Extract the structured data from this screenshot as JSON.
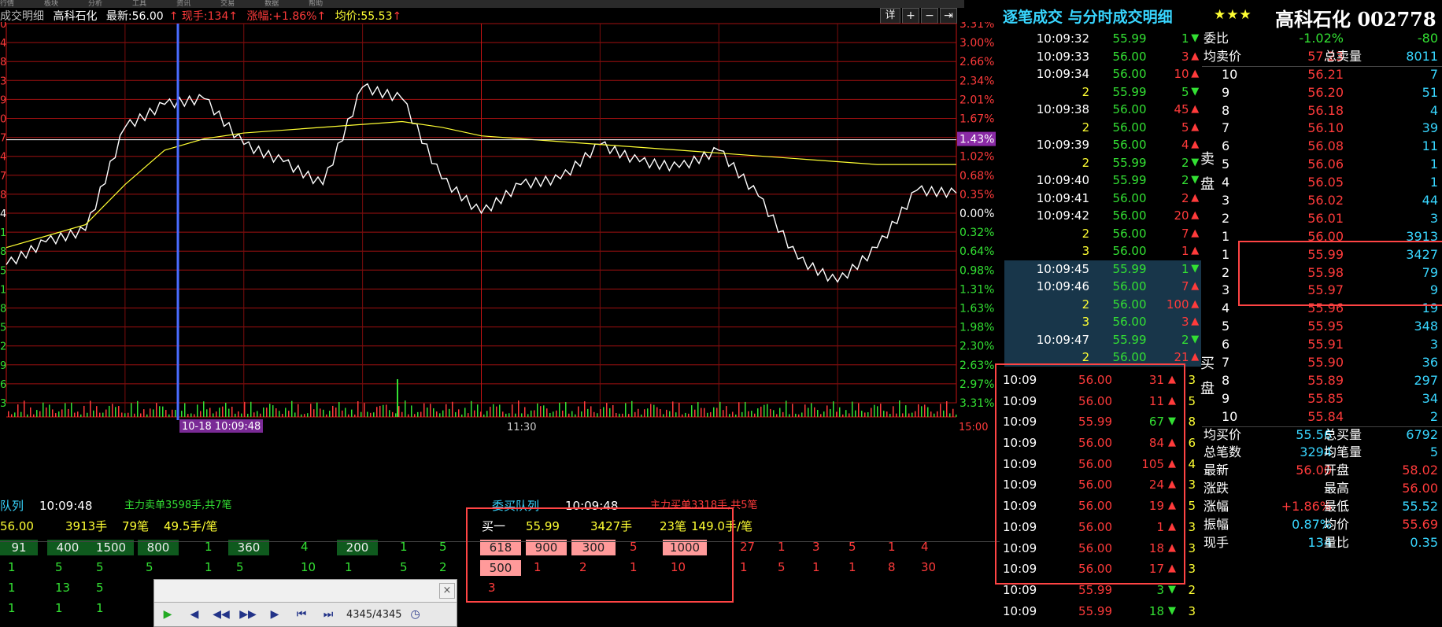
{
  "topbar": {
    "menu": [
      "行情",
      "板块",
      "分析",
      "工具",
      "资讯",
      "交易",
      "数据",
      "帮助"
    ]
  },
  "chart_header": {
    "panel_title": "成交明细",
    "stock_name": "高科石化",
    "latest_label": "最新:",
    "latest_value": "56.00",
    "volume_label": "现手:",
    "volume_value": "134",
    "change_label": "涨幅:",
    "change_value": "+1.86%",
    "avg_label": "均价:",
    "avg_value": "55.53"
  },
  "chart_tools": [
    "详",
    "+",
    "−",
    "⇥"
  ],
  "chart": {
    "pct_labels": [
      "3.31%",
      "3.00%",
      "2.66%",
      "2.34%",
      "2.01%",
      "1.67%",
      "1.43%",
      "1.02%",
      "0.68%",
      "0.35%",
      "0.00%",
      "0.32%",
      "0.64%",
      "0.98%",
      "1.31%",
      "1.63%",
      "1.98%",
      "2.30%",
      "2.63%",
      "2.97%",
      "3.31%"
    ],
    "left_marks": [
      "0",
      "4",
      "8",
      "3",
      "9",
      "0",
      "7",
      "4",
      "7",
      "8",
      "4",
      "1",
      "8",
      "5",
      "1",
      "8",
      "5",
      "2",
      "9",
      "6",
      "3"
    ],
    "cursor_time": "10-18 10:09:48",
    "mid_time": "11:30",
    "end_time": "15:00"
  },
  "chart_data": {
    "type": "line",
    "title": "",
    "xlabel": "",
    "ylabel": "",
    "ylim": [
      -3.31,
      3.31
    ],
    "x": [
      "09:30",
      "09:40",
      "09:50",
      "10:00",
      "10:10",
      "10:20",
      "10:30",
      "10:40",
      "10:50",
      "11:00",
      "11:10",
      "11:20",
      "11:30",
      "13:10",
      "13:20",
      "13:30",
      "13:40",
      "13:50",
      "14:00",
      "14:10",
      "14:20",
      "14:30",
      "14:40",
      "14:50",
      "15:00"
    ],
    "series": [
      {
        "values": [
          -0.9,
          -0.5,
          -0.3,
          1.5,
          1.9,
          2.0,
          1.2,
          0.9,
          0.5,
          2.2,
          2.0,
          0.6,
          0.0,
          0.5,
          0.6,
          1.2,
          0.9,
          0.8,
          1.1,
          0.3,
          -0.8,
          -1.2,
          -0.6,
          0.4,
          0.35
        ]
      },
      {
        "values": [
          -0.6,
          -0.4,
          -0.2,
          0.5,
          1.1,
          1.3,
          1.4,
          1.45,
          1.5,
          1.55,
          1.6,
          1.5,
          1.35,
          1.3,
          1.25,
          1.2,
          1.15,
          1.1,
          1.05,
          1.0,
          0.95,
          0.9,
          0.85,
          0.85,
          0.85
        ]
      }
    ]
  },
  "right_title": {
    "title": "逐笔成交 与分时成交明细",
    "stars": "★★★",
    "stock": "高科石化 002778"
  },
  "ticks": [
    {
      "t": "10:09:32",
      "p": "55.99",
      "v": "1",
      "d": "down",
      "hl": false
    },
    {
      "t": "10:09:33",
      "p": "56.00",
      "v": "3",
      "d": "up",
      "hl": false
    },
    {
      "t": "10:09:34",
      "p": "56.00",
      "v": "10",
      "d": "up",
      "hl": false
    },
    {
      "t": "2",
      "p": "55.99",
      "v": "5",
      "d": "down",
      "hl": false
    },
    {
      "t": "10:09:38",
      "p": "56.00",
      "v": "45",
      "d": "up",
      "hl": false
    },
    {
      "t": "2",
      "p": "56.00",
      "v": "5",
      "d": "up",
      "hl": false
    },
    {
      "t": "10:09:39",
      "p": "56.00",
      "v": "4",
      "d": "up",
      "hl": false
    },
    {
      "t": "2",
      "p": "55.99",
      "v": "2",
      "d": "down",
      "hl": false
    },
    {
      "t": "10:09:40",
      "p": "55.99",
      "v": "2",
      "d": "down",
      "hl": false
    },
    {
      "t": "10:09:41",
      "p": "56.00",
      "v": "2",
      "d": "up",
      "hl": false
    },
    {
      "t": "10:09:42",
      "p": "56.00",
      "v": "20",
      "d": "up",
      "hl": false
    },
    {
      "t": "2",
      "p": "56.00",
      "v": "7",
      "d": "up",
      "hl": false
    },
    {
      "t": "3",
      "p": "56.00",
      "v": "1",
      "d": "up",
      "hl": false
    },
    {
      "t": "10:09:45",
      "p": "55.99",
      "v": "1",
      "d": "down",
      "hl": true
    },
    {
      "t": "10:09:46",
      "p": "56.00",
      "v": "7",
      "d": "up",
      "hl": true
    },
    {
      "t": "2",
      "p": "56.00",
      "v": "100",
      "d": "up",
      "hl": true
    },
    {
      "t": "3",
      "p": "56.00",
      "v": "3",
      "d": "up",
      "hl": true
    },
    {
      "t": "10:09:47",
      "p": "55.99",
      "v": "2",
      "d": "down",
      "hl": true
    },
    {
      "t": "2",
      "p": "56.00",
      "v": "21",
      "d": "up",
      "hl": true
    }
  ],
  "ticks2": [
    {
      "t": "10:09",
      "p": "56.00",
      "v": "31",
      "d": "up",
      "x": "3"
    },
    {
      "t": "10:09",
      "p": "56.00",
      "v": "11",
      "d": "up",
      "x": "5"
    },
    {
      "t": "10:09",
      "p": "55.99",
      "v": "67",
      "d": "down",
      "x": "8"
    },
    {
      "t": "10:09",
      "p": "56.00",
      "v": "84",
      "d": "up",
      "x": "6"
    },
    {
      "t": "10:09",
      "p": "56.00",
      "v": "105",
      "d": "up",
      "x": "4"
    },
    {
      "t": "10:09",
      "p": "56.00",
      "v": "24",
      "d": "up",
      "x": "3"
    },
    {
      "t": "10:09",
      "p": "56.00",
      "v": "19",
      "d": "up",
      "x": "5"
    },
    {
      "t": "10:09",
      "p": "56.00",
      "v": "1",
      "d": "up",
      "x": "3"
    },
    {
      "t": "10:09",
      "p": "56.00",
      "v": "18",
      "d": "up",
      "x": "3"
    },
    {
      "t": "10:09",
      "p": "56.00",
      "v": "17",
      "d": "up",
      "x": "3"
    },
    {
      "t": "10:09",
      "p": "55.99",
      "v": "3",
      "d": "down",
      "x": "2"
    },
    {
      "t": "10:09",
      "p": "55.99",
      "v": "18",
      "d": "down",
      "x": "3"
    }
  ],
  "orderbook": {
    "weibi_label": "委比",
    "weibi_value": "-1.02%",
    "weibi_diff": "-80",
    "avg_sell_label": "均卖价",
    "avg_sell_value": "57.23",
    "total_sell_label": "总卖量",
    "total_sell_value": "8011",
    "sell_side_label": [
      "卖",
      "盘"
    ],
    "buy_side_label": [
      "买",
      "盘"
    ],
    "sells": [
      {
        "lvl": "10",
        "p": "56.21",
        "v": "7"
      },
      {
        "lvl": "9",
        "p": "56.20",
        "v": "51"
      },
      {
        "lvl": "8",
        "p": "56.18",
        "v": "4"
      },
      {
        "lvl": "7",
        "p": "56.10",
        "v": "39"
      },
      {
        "lvl": "6",
        "p": "56.08",
        "v": "11"
      },
      {
        "lvl": "5",
        "p": "56.06",
        "v": "1"
      },
      {
        "lvl": "4",
        "p": "56.05",
        "v": "1"
      },
      {
        "lvl": "3",
        "p": "56.02",
        "v": "44"
      },
      {
        "lvl": "2",
        "p": "56.01",
        "v": "3"
      },
      {
        "lvl": "1",
        "p": "56.00",
        "v": "3913"
      }
    ],
    "buys": [
      {
        "lvl": "1",
        "p": "55.99",
        "v": "3427"
      },
      {
        "lvl": "2",
        "p": "55.98",
        "v": "79"
      },
      {
        "lvl": "3",
        "p": "55.97",
        "v": "9"
      },
      {
        "lvl": "4",
        "p": "55.96",
        "v": "19"
      },
      {
        "lvl": "5",
        "p": "55.95",
        "v": "348"
      },
      {
        "lvl": "6",
        "p": "55.91",
        "v": "3"
      },
      {
        "lvl": "7",
        "p": "55.90",
        "v": "36"
      },
      {
        "lvl": "8",
        "p": "55.89",
        "v": "297"
      },
      {
        "lvl": "9",
        "p": "55.85",
        "v": "34"
      },
      {
        "lvl": "10",
        "p": "55.84",
        "v": "2"
      }
    ],
    "stats": [
      {
        "l1": "均买价",
        "v1": "55.56",
        "l2": "总买量",
        "v2": "6792"
      },
      {
        "l1": "总笔数",
        "v1": "3294",
        "l2": "均笔量",
        "v2": "5"
      },
      {
        "l1": "最新",
        "v1": "56.00",
        "l2": "开盘",
        "v2": "58.02"
      },
      {
        "l1": "涨跌",
        "v1": "-",
        "l2": "最高",
        "v2": "56.00"
      },
      {
        "l1": "涨幅",
        "v1": "+1.86%",
        "l2": "最低",
        "v2": "55.52"
      },
      {
        "l1": "振幅",
        "v1": "0.87%",
        "l2": "均价",
        "v2": "55.69"
      },
      {
        "l1": "现手",
        "v1": "134",
        "l2": "量比",
        "v2": "0.35"
      }
    ]
  },
  "queue": {
    "sell_title": "队列",
    "sell_time": "10:09:48",
    "sell_info": "主力卖单3598手,共7笔",
    "buy_title": "委买队列",
    "buy_time": "10:09:48",
    "buy_info": "主力买单3318手,共5笔",
    "sell_head": {
      "price": "56.00",
      "vol": "3913手",
      "cnt": "79笔",
      "avg": "49.5手/笔"
    },
    "buy_head": {
      "label": "买一",
      "price": "55.99",
      "vol": "3427手",
      "cnt": "23笔",
      "avg": "149.0手/笔"
    },
    "sell_rows": [
      [
        "91",
        "400",
        "1500",
        "800",
        "1",
        "360",
        "4",
        "200",
        "1",
        "5"
      ],
      [
        "1",
        "5",
        "5",
        "5",
        "1",
        "5",
        "10",
        "1",
        "5",
        "2"
      ],
      [
        "1",
        "13",
        "5"
      ],
      [
        "1",
        "1",
        "1"
      ]
    ],
    "buy_rows": [
      [
        "618",
        "900",
        "300",
        "5",
        "1000",
        "27",
        "1",
        "3",
        "5",
        "1",
        "4"
      ],
      [
        "500",
        "1",
        "2",
        "1",
        "10",
        "1",
        "5",
        "1",
        "1",
        "8",
        "30"
      ],
      [
        "3"
      ]
    ]
  },
  "player": {
    "counter": "4345/4345"
  }
}
